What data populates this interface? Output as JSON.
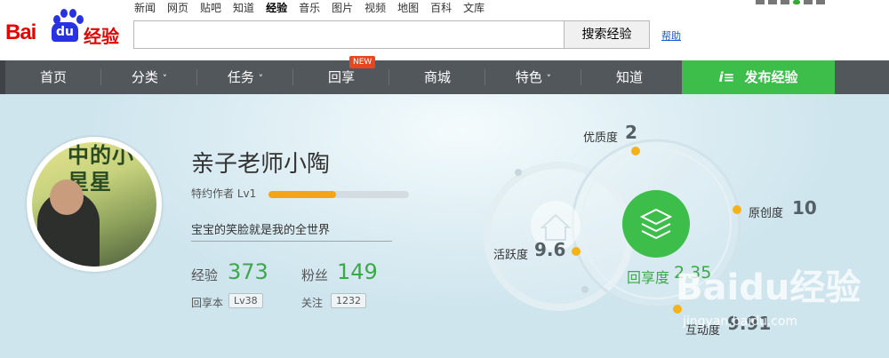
{
  "logo": {
    "bai": "Bai",
    "du": "du",
    "jingyan": "经验"
  },
  "topnav": [
    {
      "label": "新闻",
      "active": false
    },
    {
      "label": "网页",
      "active": false
    },
    {
      "label": "贴吧",
      "active": false
    },
    {
      "label": "知道",
      "active": false
    },
    {
      "label": "经验",
      "active": true
    },
    {
      "label": "音乐",
      "active": false
    },
    {
      "label": "图片",
      "active": false
    },
    {
      "label": "视频",
      "active": false
    },
    {
      "label": "地图",
      "active": false
    },
    {
      "label": "百科",
      "active": false
    },
    {
      "label": "文库",
      "active": false
    }
  ],
  "search": {
    "value": "",
    "button": "搜索经验",
    "help": "帮助"
  },
  "mainnav": [
    {
      "label": "首页",
      "caret": ""
    },
    {
      "label": "分类",
      "caret": "˅"
    },
    {
      "label": "任务",
      "caret": "˅"
    },
    {
      "label": "回享",
      "caret": ""
    },
    {
      "label": "商城",
      "caret": ""
    },
    {
      "label": "特色",
      "caret": "˅"
    },
    {
      "label": "知道",
      "caret": ""
    }
  ],
  "new_badge": "NEW",
  "publish": {
    "icon": "i≡",
    "label": "发布经验"
  },
  "profile": {
    "avatar_text": "中的小星星",
    "username": "亲子老师小陶",
    "role": "特约作者 Lv1",
    "level_progress": 0.48,
    "motto": "宝宝的笑脸就是我的全世界",
    "experience_label": "经验",
    "experience_value": "373",
    "fans_label": "粉丝",
    "fans_value": "149",
    "huixiang_label": "回享本",
    "huixiang_badge": "Lv38",
    "follow_label": "关注",
    "follow_badge": "1232"
  },
  "metrics": {
    "quality": {
      "label": "优质度",
      "value": "2"
    },
    "originality": {
      "label": "原创度",
      "value": "10"
    },
    "activity": {
      "label": "活跃度",
      "value": "9.6"
    },
    "sharing": {
      "label": "回享度",
      "value": "2.35"
    },
    "interaction": {
      "label": "互动度",
      "value": "9.91"
    }
  },
  "colors": {
    "accent_green": "#3dbe4a",
    "nav_bg": "#52575c",
    "orange": "#f5a31a"
  },
  "watermark": {
    "text": "Baidu经验",
    "url": "jingyan.baidu.com"
  }
}
